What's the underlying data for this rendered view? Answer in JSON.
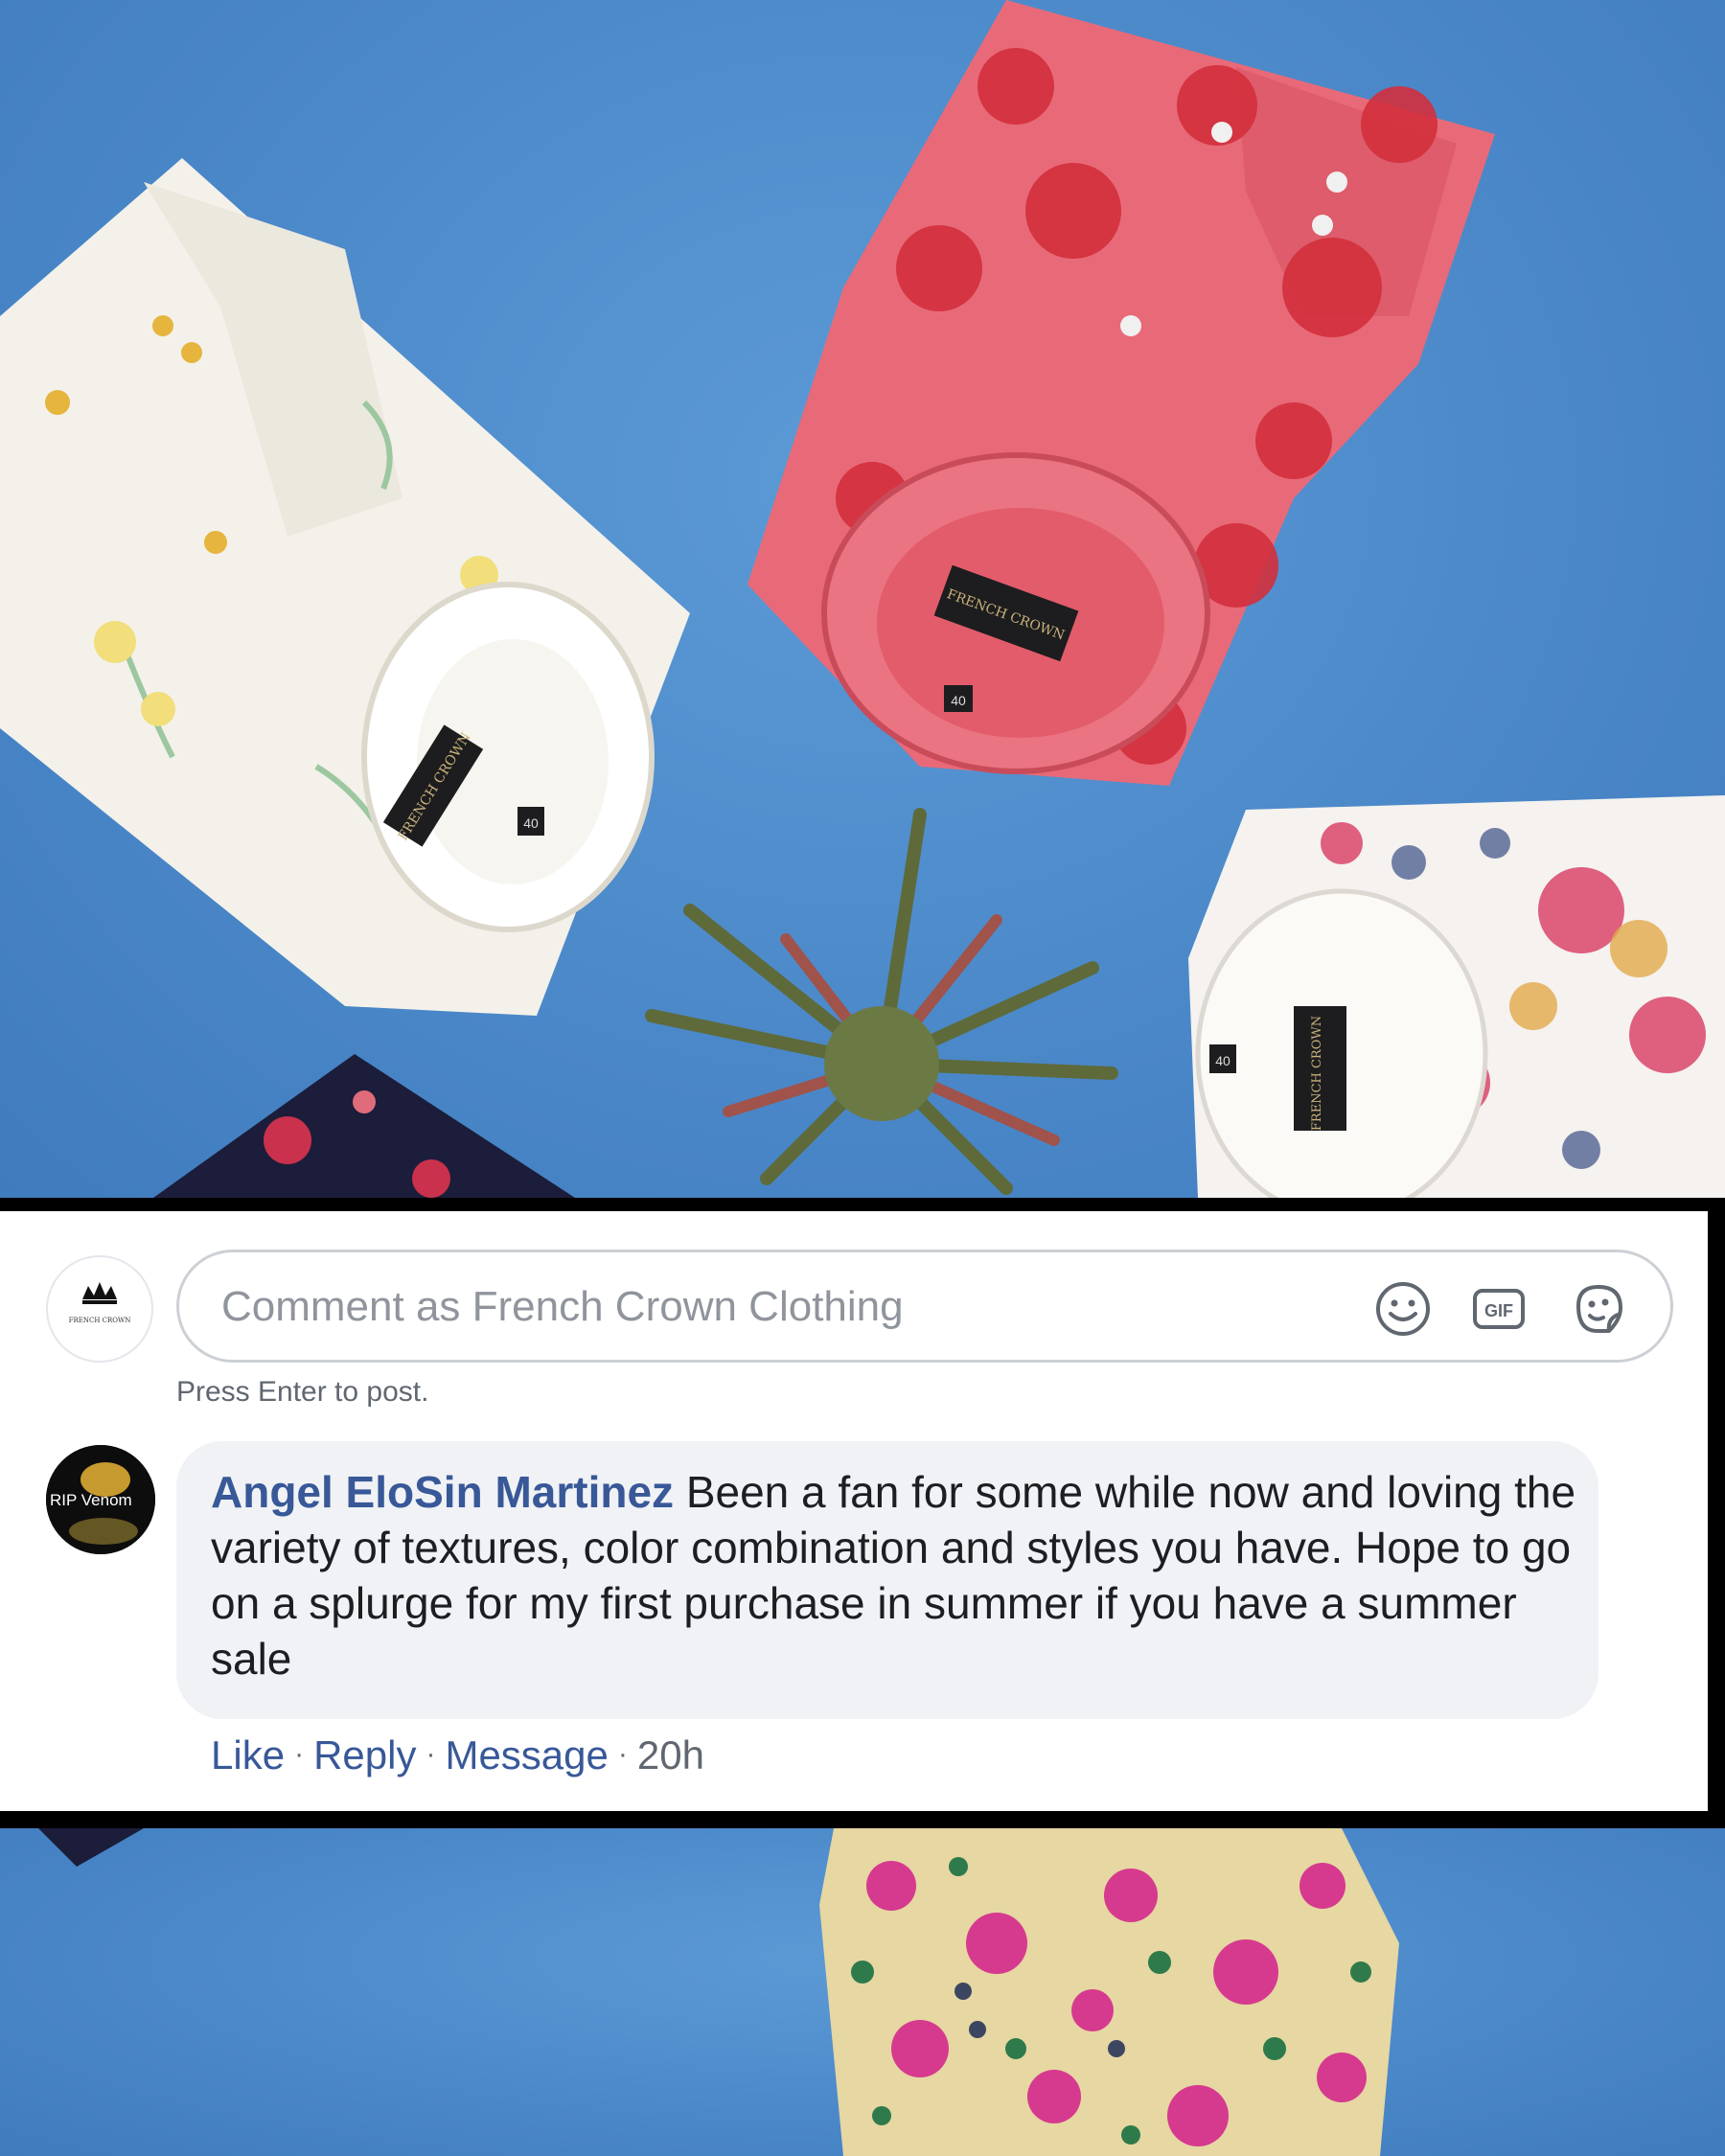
{
  "photo": {
    "label_white_shirt": "FRENCH CROWN",
    "size_white_shirt": "40",
    "label_red_shirt": "FRENCH CROWN",
    "size_red_shirt": "40",
    "label_floral_shirt": "FRENCH CROWN",
    "size_floral_shirt": "40"
  },
  "comment_composer": {
    "placeholder": "Comment as French Crown Clothing",
    "hint": "Press Enter to post.",
    "page_logo_text": "FRENCH CROWN",
    "icons": [
      "emoji-icon",
      "gif-icon",
      "sticker-icon"
    ],
    "gif_label": "GIF"
  },
  "comment": {
    "avatar_text": "RIP Venom",
    "author": "Angel EloSin Martinez",
    "text": "Been a fan for some while now and loving the variety of textures, color combination and styles you have. Hope to go on a splurge for my first purchase in summer if you have a summer sale",
    "actions": {
      "like": "Like",
      "reply": "Reply",
      "message": "Message",
      "time": "20h"
    }
  },
  "colors": {
    "background": "#4f8ccc",
    "link": "#385898",
    "bubble": "#f0f2f5"
  }
}
